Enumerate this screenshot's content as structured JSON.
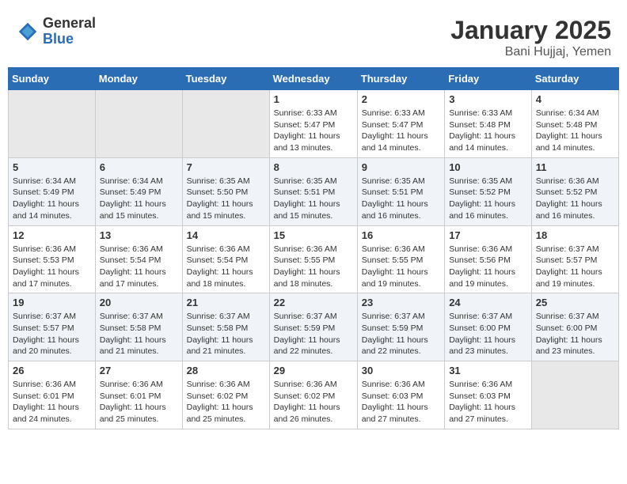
{
  "header": {
    "logo_general": "General",
    "logo_blue": "Blue",
    "month_year": "January 2025",
    "location": "Bani Hujjaj, Yemen"
  },
  "weekdays": [
    "Sunday",
    "Monday",
    "Tuesday",
    "Wednesday",
    "Thursday",
    "Friday",
    "Saturday"
  ],
  "weeks": [
    [
      {
        "day": "",
        "sunrise": "",
        "sunset": "",
        "daylight": ""
      },
      {
        "day": "",
        "sunrise": "",
        "sunset": "",
        "daylight": ""
      },
      {
        "day": "",
        "sunrise": "",
        "sunset": "",
        "daylight": ""
      },
      {
        "day": "1",
        "sunrise": "Sunrise: 6:33 AM",
        "sunset": "Sunset: 5:47 PM",
        "daylight": "Daylight: 11 hours and 13 minutes."
      },
      {
        "day": "2",
        "sunrise": "Sunrise: 6:33 AM",
        "sunset": "Sunset: 5:47 PM",
        "daylight": "Daylight: 11 hours and 14 minutes."
      },
      {
        "day": "3",
        "sunrise": "Sunrise: 6:33 AM",
        "sunset": "Sunset: 5:48 PM",
        "daylight": "Daylight: 11 hours and 14 minutes."
      },
      {
        "day": "4",
        "sunrise": "Sunrise: 6:34 AM",
        "sunset": "Sunset: 5:48 PM",
        "daylight": "Daylight: 11 hours and 14 minutes."
      }
    ],
    [
      {
        "day": "5",
        "sunrise": "Sunrise: 6:34 AM",
        "sunset": "Sunset: 5:49 PM",
        "daylight": "Daylight: 11 hours and 14 minutes."
      },
      {
        "day": "6",
        "sunrise": "Sunrise: 6:34 AM",
        "sunset": "Sunset: 5:49 PM",
        "daylight": "Daylight: 11 hours and 15 minutes."
      },
      {
        "day": "7",
        "sunrise": "Sunrise: 6:35 AM",
        "sunset": "Sunset: 5:50 PM",
        "daylight": "Daylight: 11 hours and 15 minutes."
      },
      {
        "day": "8",
        "sunrise": "Sunrise: 6:35 AM",
        "sunset": "Sunset: 5:51 PM",
        "daylight": "Daylight: 11 hours and 15 minutes."
      },
      {
        "day": "9",
        "sunrise": "Sunrise: 6:35 AM",
        "sunset": "Sunset: 5:51 PM",
        "daylight": "Daylight: 11 hours and 16 minutes."
      },
      {
        "day": "10",
        "sunrise": "Sunrise: 6:35 AM",
        "sunset": "Sunset: 5:52 PM",
        "daylight": "Daylight: 11 hours and 16 minutes."
      },
      {
        "day": "11",
        "sunrise": "Sunrise: 6:36 AM",
        "sunset": "Sunset: 5:52 PM",
        "daylight": "Daylight: 11 hours and 16 minutes."
      }
    ],
    [
      {
        "day": "12",
        "sunrise": "Sunrise: 6:36 AM",
        "sunset": "Sunset: 5:53 PM",
        "daylight": "Daylight: 11 hours and 17 minutes."
      },
      {
        "day": "13",
        "sunrise": "Sunrise: 6:36 AM",
        "sunset": "Sunset: 5:54 PM",
        "daylight": "Daylight: 11 hours and 17 minutes."
      },
      {
        "day": "14",
        "sunrise": "Sunrise: 6:36 AM",
        "sunset": "Sunset: 5:54 PM",
        "daylight": "Daylight: 11 hours and 18 minutes."
      },
      {
        "day": "15",
        "sunrise": "Sunrise: 6:36 AM",
        "sunset": "Sunset: 5:55 PM",
        "daylight": "Daylight: 11 hours and 18 minutes."
      },
      {
        "day": "16",
        "sunrise": "Sunrise: 6:36 AM",
        "sunset": "Sunset: 5:55 PM",
        "daylight": "Daylight: 11 hours and 19 minutes."
      },
      {
        "day": "17",
        "sunrise": "Sunrise: 6:36 AM",
        "sunset": "Sunset: 5:56 PM",
        "daylight": "Daylight: 11 hours and 19 minutes."
      },
      {
        "day": "18",
        "sunrise": "Sunrise: 6:37 AM",
        "sunset": "Sunset: 5:57 PM",
        "daylight": "Daylight: 11 hours and 19 minutes."
      }
    ],
    [
      {
        "day": "19",
        "sunrise": "Sunrise: 6:37 AM",
        "sunset": "Sunset: 5:57 PM",
        "daylight": "Daylight: 11 hours and 20 minutes."
      },
      {
        "day": "20",
        "sunrise": "Sunrise: 6:37 AM",
        "sunset": "Sunset: 5:58 PM",
        "daylight": "Daylight: 11 hours and 21 minutes."
      },
      {
        "day": "21",
        "sunrise": "Sunrise: 6:37 AM",
        "sunset": "Sunset: 5:58 PM",
        "daylight": "Daylight: 11 hours and 21 minutes."
      },
      {
        "day": "22",
        "sunrise": "Sunrise: 6:37 AM",
        "sunset": "Sunset: 5:59 PM",
        "daylight": "Daylight: 11 hours and 22 minutes."
      },
      {
        "day": "23",
        "sunrise": "Sunrise: 6:37 AM",
        "sunset": "Sunset: 5:59 PM",
        "daylight": "Daylight: 11 hours and 22 minutes."
      },
      {
        "day": "24",
        "sunrise": "Sunrise: 6:37 AM",
        "sunset": "Sunset: 6:00 PM",
        "daylight": "Daylight: 11 hours and 23 minutes."
      },
      {
        "day": "25",
        "sunrise": "Sunrise: 6:37 AM",
        "sunset": "Sunset: 6:00 PM",
        "daylight": "Daylight: 11 hours and 23 minutes."
      }
    ],
    [
      {
        "day": "26",
        "sunrise": "Sunrise: 6:36 AM",
        "sunset": "Sunset: 6:01 PM",
        "daylight": "Daylight: 11 hours and 24 minutes."
      },
      {
        "day": "27",
        "sunrise": "Sunrise: 6:36 AM",
        "sunset": "Sunset: 6:01 PM",
        "daylight": "Daylight: 11 hours and 25 minutes."
      },
      {
        "day": "28",
        "sunrise": "Sunrise: 6:36 AM",
        "sunset": "Sunset: 6:02 PM",
        "daylight": "Daylight: 11 hours and 25 minutes."
      },
      {
        "day": "29",
        "sunrise": "Sunrise: 6:36 AM",
        "sunset": "Sunset: 6:02 PM",
        "daylight": "Daylight: 11 hours and 26 minutes."
      },
      {
        "day": "30",
        "sunrise": "Sunrise: 6:36 AM",
        "sunset": "Sunset: 6:03 PM",
        "daylight": "Daylight: 11 hours and 27 minutes."
      },
      {
        "day": "31",
        "sunrise": "Sunrise: 6:36 AM",
        "sunset": "Sunset: 6:03 PM",
        "daylight": "Daylight: 11 hours and 27 minutes."
      },
      {
        "day": "",
        "sunrise": "",
        "sunset": "",
        "daylight": ""
      }
    ]
  ],
  "colors": {
    "header_bg": "#2a6db5",
    "odd_row": "#ffffff",
    "even_row": "#f0f4f8",
    "empty_cell": "#e8e8e8"
  }
}
